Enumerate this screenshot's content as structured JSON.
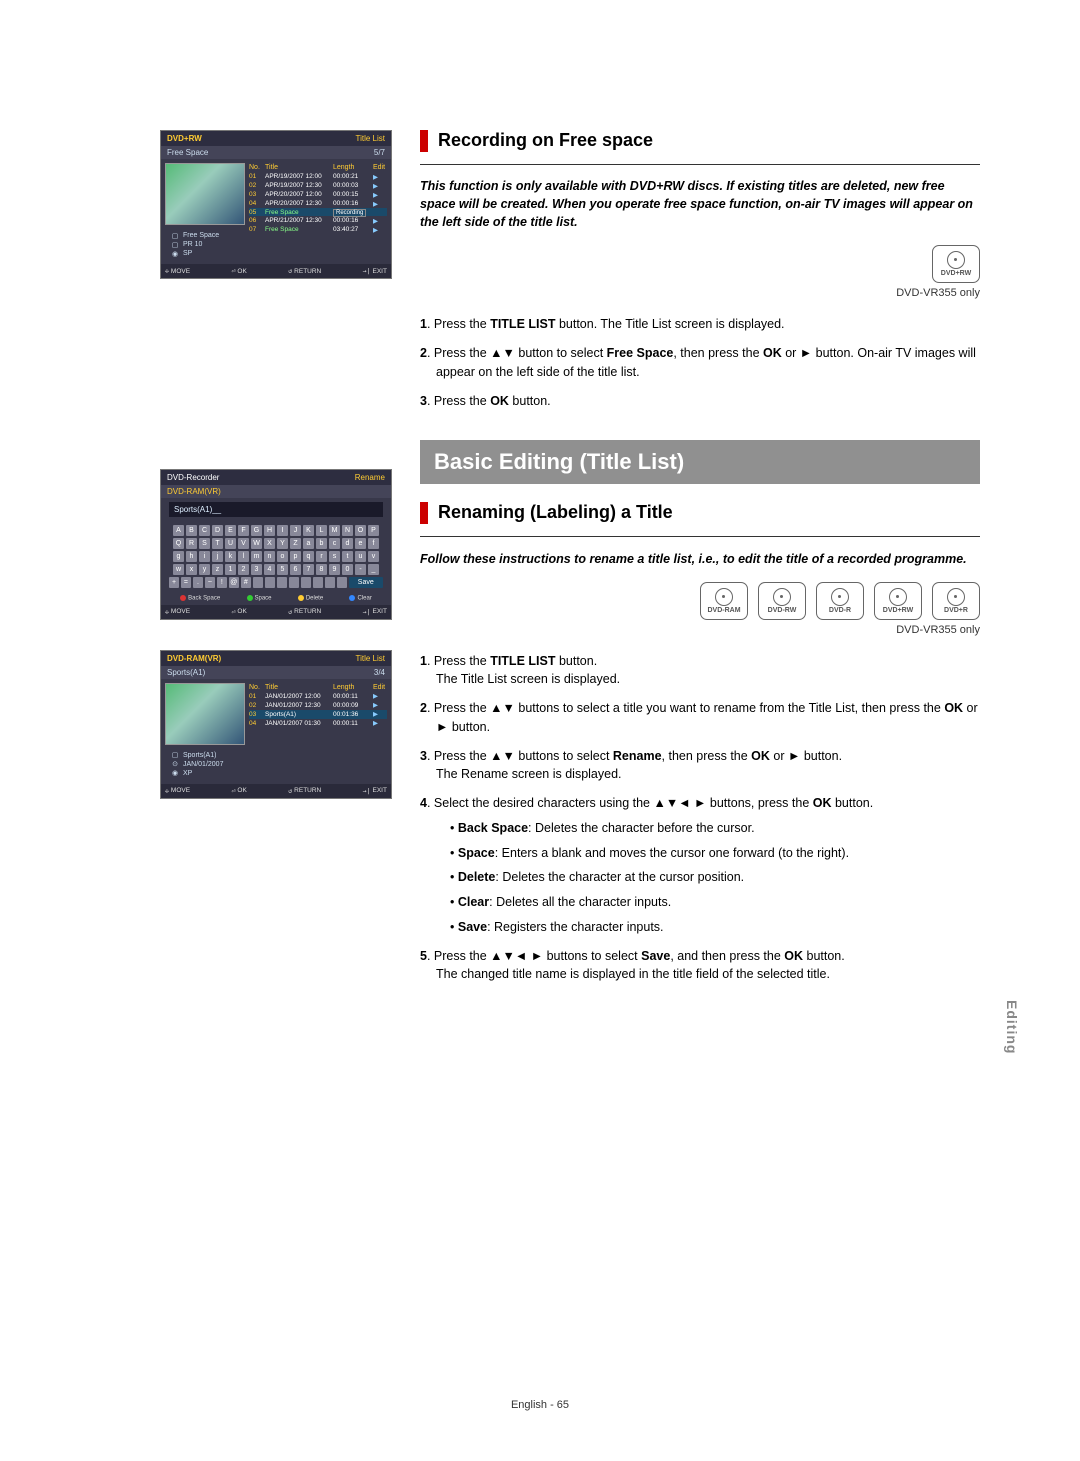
{
  "osd1": {
    "disc": "DVD+RW",
    "header_title": "Title List",
    "sub_left": "Free Space",
    "sub_right": "5/7",
    "listhead": {
      "no": "No.",
      "title": "Title",
      "length": "Length",
      "edit": "Edit"
    },
    "rows": [
      {
        "no": "01",
        "title": "APR/19/2007 12:00",
        "len": "00:00:21",
        "ed": "▶"
      },
      {
        "no": "02",
        "title": "APR/19/2007 12:30",
        "len": "00:00:03",
        "ed": "▶"
      },
      {
        "no": "03",
        "title": "APR/20/2007 12:00",
        "len": "00:00:15",
        "ed": "▶"
      },
      {
        "no": "04",
        "title": "APR/20/2007 12:30",
        "len": "00:00:16",
        "ed": "▶"
      },
      {
        "no": "05",
        "title": "Free Space",
        "len": "Recording",
        "ed": "",
        "hi": true,
        "free": true
      },
      {
        "no": "06",
        "title": "APR/21/2007 12:30",
        "len": "00:00:16",
        "ed": "▶"
      },
      {
        "no": "07",
        "title": "Free Space",
        "len": "03:40:27",
        "ed": "▶",
        "free": true
      }
    ],
    "info": [
      {
        "icon": "▢",
        "txt": "Free Space"
      },
      {
        "icon": "▢",
        "txt": "PR 10"
      },
      {
        "icon": "◉",
        "txt": "SP"
      }
    ],
    "nav": {
      "move": "MOVE",
      "ok": "OK",
      "ret": "RETURN",
      "exit": "EXIT"
    }
  },
  "osd2": {
    "header_left": "DVD-Recorder",
    "header_right": "Rename",
    "disc": "DVD-RAM(VR)",
    "input": "Sports(A1)__",
    "keys": [
      [
        "A",
        "B",
        "C",
        "D",
        "E",
        "F",
        "G",
        "H",
        "I",
        "J",
        "K",
        "L",
        "M",
        "N",
        "O",
        "P"
      ],
      [
        "Q",
        "R",
        "S",
        "T",
        "U",
        "V",
        "W",
        "X",
        "Y",
        "Z",
        "a",
        "b",
        "c",
        "d",
        "e",
        "f"
      ],
      [
        "g",
        "h",
        "i",
        "j",
        "k",
        "l",
        "m",
        "n",
        "o",
        "p",
        "q",
        "r",
        "s",
        "t",
        "u",
        "v"
      ],
      [
        "w",
        "x",
        "y",
        "z",
        "1",
        "2",
        "3",
        "4",
        "5",
        "6",
        "7",
        "8",
        "9",
        "0",
        "-",
        "_"
      ],
      [
        "+",
        "=",
        ".",
        "~",
        "!",
        "@",
        "#",
        "",
        "",
        "",
        "",
        "",
        "",
        "",
        ""
      ]
    ],
    "save": "Save",
    "funcs": {
      "back": "Back Space",
      "space": "Space",
      "delete": "Delete",
      "clear": "Clear"
    },
    "nav": {
      "move": "MOVE",
      "ok": "OK",
      "ret": "RETURN",
      "exit": "EXIT"
    }
  },
  "osd3": {
    "disc": "DVD-RAM(VR)",
    "header_title": "Title List",
    "sub_left": "Sports(A1)",
    "sub_right": "3/4",
    "listhead": {
      "no": "No.",
      "title": "Title",
      "length": "Length",
      "edit": "Edit"
    },
    "rows": [
      {
        "no": "01",
        "title": "JAN/01/2007 12:00",
        "len": "00:00:11",
        "ed": "▶"
      },
      {
        "no": "02",
        "title": "JAN/01/2007 12:30",
        "len": "00:00:09",
        "ed": "▶"
      },
      {
        "no": "03",
        "title": "Sports(A1)",
        "len": "00:01:36",
        "ed": "▶",
        "hi": true
      },
      {
        "no": "04",
        "title": "JAN/01/2007 01:30",
        "len": "00:00:11",
        "ed": "▶"
      }
    ],
    "info": [
      {
        "icon": "▢",
        "txt": "Sports(A1)"
      },
      {
        "icon": "⊙",
        "txt": "JAN/01/2007"
      },
      {
        "icon": "◉",
        "txt": "XP"
      }
    ],
    "nav": {
      "move": "MOVE",
      "ok": "OK",
      "ret": "RETURN",
      "exit": "EXIT"
    }
  },
  "sec1": {
    "title": "Recording on Free space",
    "lead": "This function is only available with DVD+RW discs. If existing titles are deleted, new free space will be created. When you operate free space function, on-air TV images will appear on the left side of the title list.",
    "discs": [
      "DVD+RW"
    ],
    "caption": "DVD-VR355 only",
    "steps": [
      {
        "n": "1",
        "pre": ". Press the ",
        "b1": "TITLE LIST",
        "post": " button. The Title List screen is displayed."
      },
      {
        "n": "2",
        "pre": ". Press the ▲▼ button to select ",
        "b1": "Free Space",
        "mid": ", then press the ",
        "b2": "OK",
        "post": " or ► button. On-air TV images will appear on the left side of the title list."
      },
      {
        "n": "3",
        "pre": ". Press the ",
        "b1": "OK",
        "post": " button."
      }
    ]
  },
  "bigbar": "Basic Editing (Title List)",
  "sec2": {
    "title": "Renaming (Labeling) a Title",
    "lead": "Follow these instructions to rename a title list, i.e., to edit the title of a recorded programme.",
    "discs": [
      "DVD-RAM",
      "DVD-RW",
      "DVD-R",
      "DVD+RW",
      "DVD+R"
    ],
    "caption": "DVD-VR355 only",
    "steps": [
      {
        "n": "1",
        "txt": ". Press the <b>TITLE LIST</b> button.<br>The Title List screen is displayed."
      },
      {
        "n": "2",
        "txt": ". Press the ▲▼ buttons to select a title you want to rename from the Title List, then press the <b>OK</b> or ► button."
      },
      {
        "n": "3",
        "txt": ". Press the ▲▼ buttons to select <b>Rename</b>, then press the <b>OK</b> or ► button.<br>The Rename screen is displayed."
      },
      {
        "n": "4",
        "txt": ". Select the desired characters using the ▲▼◄ ► buttons, press the <b>OK</b> button."
      },
      {
        "n": "5",
        "txt": ". Press the ▲▼◄ ► buttons to select <b>Save</b>, and then press the <b>OK</b> button.<br>The changed title name is displayed in the title field of the selected title."
      }
    ],
    "subs": [
      {
        "b": "Back Space",
        "t": ": Deletes the character before the cursor."
      },
      {
        "b": "Space",
        "t": ": Enters a blank and moves the cursor one forward (to the right)."
      },
      {
        "b": "Delete",
        "t": ": Deletes the character at the cursor position."
      },
      {
        "b": "Clear",
        "t": ": Deletes all the character inputs."
      },
      {
        "b": "Save",
        "t": ": Registers the character inputs."
      }
    ]
  },
  "sidetab": "Editing",
  "footer": "English - 65"
}
